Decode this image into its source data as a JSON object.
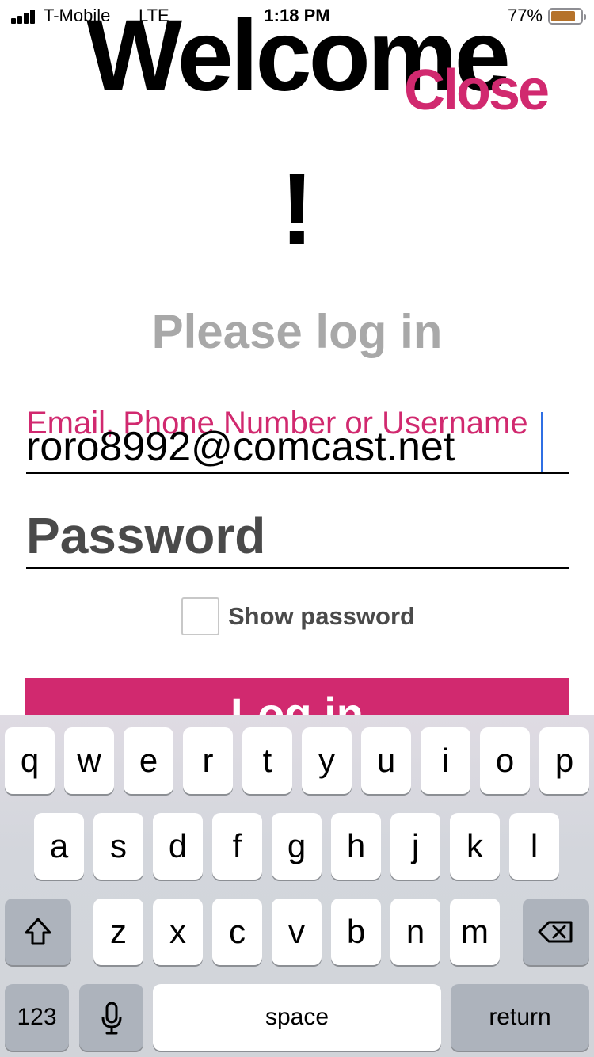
{
  "status_bar": {
    "carrier": "T-Mobile",
    "network": "LTE",
    "time": "1:18 PM",
    "battery_percent": "77%",
    "battery_level": 0.77
  },
  "header": {
    "title": "Welcome",
    "title_suffix": "!",
    "close_label": "Close"
  },
  "subtitle": "Please log in",
  "form": {
    "username_label": "Email, Phone Number or Username",
    "username_value": "roro8992@comcast.net",
    "password_placeholder": "Password",
    "show_password_label": "Show password",
    "show_password_checked": false,
    "login_label": "Log in"
  },
  "colors": {
    "accent": "#d1296f",
    "subtitle_gray": "#a8a8a8",
    "caret_blue": "#2f6fe4"
  },
  "keyboard": {
    "row1": [
      "q",
      "w",
      "e",
      "r",
      "t",
      "y",
      "u",
      "i",
      "o",
      "p"
    ],
    "row2": [
      "a",
      "s",
      "d",
      "f",
      "g",
      "h",
      "j",
      "k",
      "l"
    ],
    "row3": [
      "z",
      "x",
      "c",
      "v",
      "b",
      "n",
      "m"
    ],
    "numbers_label": "123",
    "space_label": "space",
    "return_label": "return",
    "icons": [
      "shift-icon",
      "backspace-icon",
      "microphone-icon"
    ]
  }
}
